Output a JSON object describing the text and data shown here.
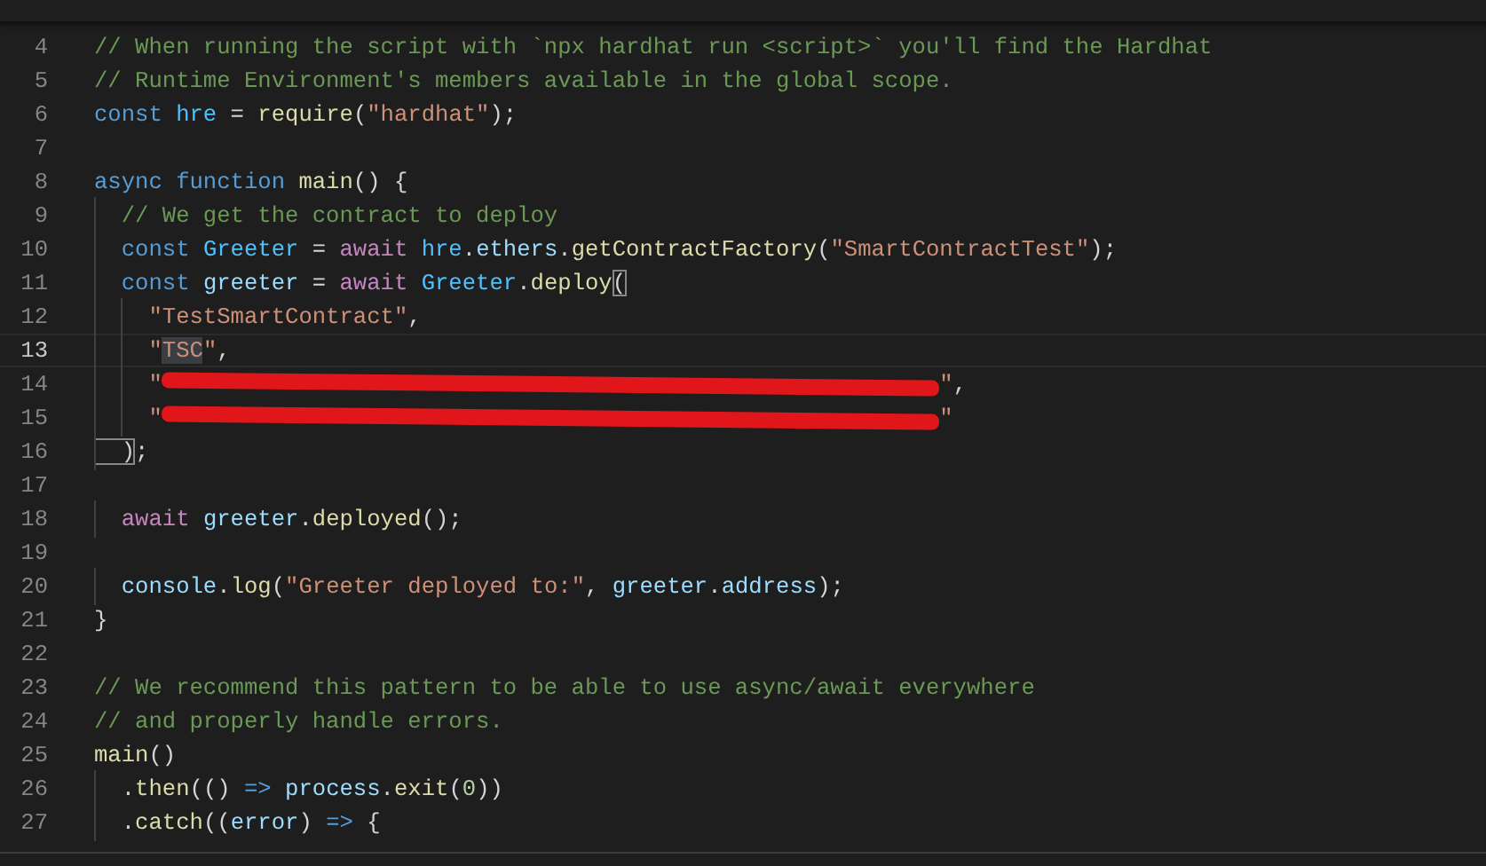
{
  "lines": [
    {
      "number": "4",
      "selected": false,
      "tokens": [
        {
          "kind": "c",
          "text": "// When running the script with `npx hardhat run <script>` you'll find the Hardhat"
        }
      ]
    },
    {
      "number": "5",
      "selected": false,
      "tokens": [
        {
          "kind": "c",
          "text": "// Runtime Environment's members available in the global scope."
        }
      ]
    },
    {
      "number": "6",
      "selected": false,
      "tokens": [
        {
          "kind": "k",
          "text": "const "
        },
        {
          "kind": "cv",
          "text": "hre"
        },
        {
          "kind": "p",
          "text": " = "
        },
        {
          "kind": "f",
          "text": "require"
        },
        {
          "kind": "p",
          "text": "("
        },
        {
          "kind": "s",
          "text": "\"hardhat\""
        },
        {
          "kind": "p",
          "text": ");"
        }
      ]
    },
    {
      "number": "7",
      "selected": false
    },
    {
      "number": "8",
      "selected": false,
      "tokens": [
        {
          "kind": "k",
          "text": "async function "
        },
        {
          "kind": "f",
          "text": "main"
        },
        {
          "kind": "p",
          "text": "() {"
        }
      ]
    },
    {
      "number": "9",
      "selected": false,
      "tokens": [
        {
          "kind": "c",
          "text": "  // We get the contract to deploy"
        }
      ]
    },
    {
      "number": "10",
      "selected": false,
      "tokens": [
        {
          "kind": "k",
          "text": "  const "
        },
        {
          "kind": "cv",
          "text": "Greeter"
        },
        {
          "kind": "p",
          "text": " = "
        },
        {
          "kind": "ctl",
          "text": "await "
        },
        {
          "kind": "cv",
          "text": "hre"
        },
        {
          "kind": "p",
          "text": "."
        },
        {
          "kind": "v",
          "text": "ethers"
        },
        {
          "kind": "p",
          "text": "."
        },
        {
          "kind": "f",
          "text": "getContractFactory"
        },
        {
          "kind": "p",
          "text": "("
        },
        {
          "kind": "s",
          "text": "\"SmartContractTest\""
        },
        {
          "kind": "p",
          "text": ");"
        }
      ]
    },
    {
      "number": "11",
      "selected": false,
      "tokens": [
        {
          "kind": "k",
          "text": "  const "
        },
        {
          "kind": "v",
          "text": "greeter"
        },
        {
          "kind": "p",
          "text": " = "
        },
        {
          "kind": "ctl",
          "text": "await "
        },
        {
          "kind": "cv",
          "text": "Greeter"
        },
        {
          "kind": "p",
          "text": "."
        },
        {
          "kind": "f",
          "text": "deploy"
        },
        {
          "kind": "b",
          "text": "("
        }
      ]
    },
    {
      "number": "12",
      "selected": false,
      "tokens": [
        {
          "kind": "s",
          "text": "    \"TestSmartContract\""
        },
        {
          "kind": "p",
          "text": ","
        }
      ]
    },
    {
      "number": "13",
      "selected": true,
      "tokens": [
        {
          "kind": "s",
          "text": "    \""
        },
        {
          "kind": "m",
          "text": "TSC"
        },
        {
          "kind": "s",
          "text": "\""
        },
        {
          "kind": "p",
          "text": ","
        }
      ]
    },
    {
      "number": "14",
      "selected": false,
      "tokens": [
        {
          "kind": "s",
          "text": "    \""
        },
        {
          "kind": "r"
        },
        {
          "kind": "s",
          "text": "\""
        },
        {
          "kind": "p",
          "text": ","
        }
      ]
    },
    {
      "number": "15",
      "selected": false,
      "tokens": [
        {
          "kind": "s",
          "text": "    \""
        },
        {
          "kind": "r"
        },
        {
          "kind": "s",
          "text": "\""
        }
      ]
    },
    {
      "number": "16",
      "selected": false,
      "tokens": [
        {
          "kind": "b",
          "text": "  )"
        },
        {
          "kind": "p",
          "text": ";"
        }
      ]
    },
    {
      "number": "17",
      "selected": false
    },
    {
      "number": "18",
      "selected": false,
      "tokens": [
        {
          "kind": "ctl",
          "text": "  await "
        },
        {
          "kind": "v",
          "text": "greeter"
        },
        {
          "kind": "p",
          "text": "."
        },
        {
          "kind": "f",
          "text": "deployed"
        },
        {
          "kind": "p",
          "text": "();"
        }
      ]
    },
    {
      "number": "19",
      "selected": false
    },
    {
      "number": "20",
      "selected": false,
      "tokens": [
        {
          "kind": "v",
          "text": "  console"
        },
        {
          "kind": "p",
          "text": "."
        },
        {
          "kind": "f",
          "text": "log"
        },
        {
          "kind": "p",
          "text": "("
        },
        {
          "kind": "s",
          "text": "\"Greeter deployed to:\""
        },
        {
          "kind": "p",
          "text": ", "
        },
        {
          "kind": "v",
          "text": "greeter"
        },
        {
          "kind": "p",
          "text": "."
        },
        {
          "kind": "v",
          "text": "address"
        },
        {
          "kind": "p",
          "text": ");"
        }
      ]
    },
    {
      "number": "21",
      "selected": false,
      "tokens": [
        {
          "kind": "p",
          "text": "}"
        }
      ]
    },
    {
      "number": "22",
      "selected": false
    },
    {
      "number": "23",
      "selected": false,
      "tokens": [
        {
          "kind": "c",
          "text": "// We recommend this pattern to be able to use async/await everywhere"
        }
      ]
    },
    {
      "number": "24",
      "selected": false,
      "tokens": [
        {
          "kind": "c",
          "text": "// and properly handle errors."
        }
      ]
    },
    {
      "number": "25",
      "selected": false,
      "tokens": [
        {
          "kind": "f",
          "text": "main"
        },
        {
          "kind": "p",
          "text": "()"
        }
      ]
    },
    {
      "number": "26",
      "selected": false,
      "tokens": [
        {
          "kind": "p",
          "text": "  ."
        },
        {
          "kind": "f",
          "text": "then"
        },
        {
          "kind": "p",
          "text": "(() "
        },
        {
          "kind": "k",
          "text": "=> "
        },
        {
          "kind": "v",
          "text": "process"
        },
        {
          "kind": "p",
          "text": "."
        },
        {
          "kind": "f",
          "text": "exit"
        },
        {
          "kind": "p",
          "text": "("
        },
        {
          "kind": "n",
          "text": "0"
        },
        {
          "kind": "p",
          "text": "))"
        }
      ]
    },
    {
      "number": "27",
      "selected": false,
      "tokens": [
        {
          "kind": "p",
          "text": "  ."
        },
        {
          "kind": "f",
          "text": "catch"
        },
        {
          "kind": "p",
          "text": "(("
        },
        {
          "kind": "v",
          "text": "error"
        },
        {
          "kind": "p",
          "text": ") "
        },
        {
          "kind": "k",
          "text": "=>"
        },
        {
          "kind": "p",
          "text": " {"
        }
      ]
    }
  ]
}
